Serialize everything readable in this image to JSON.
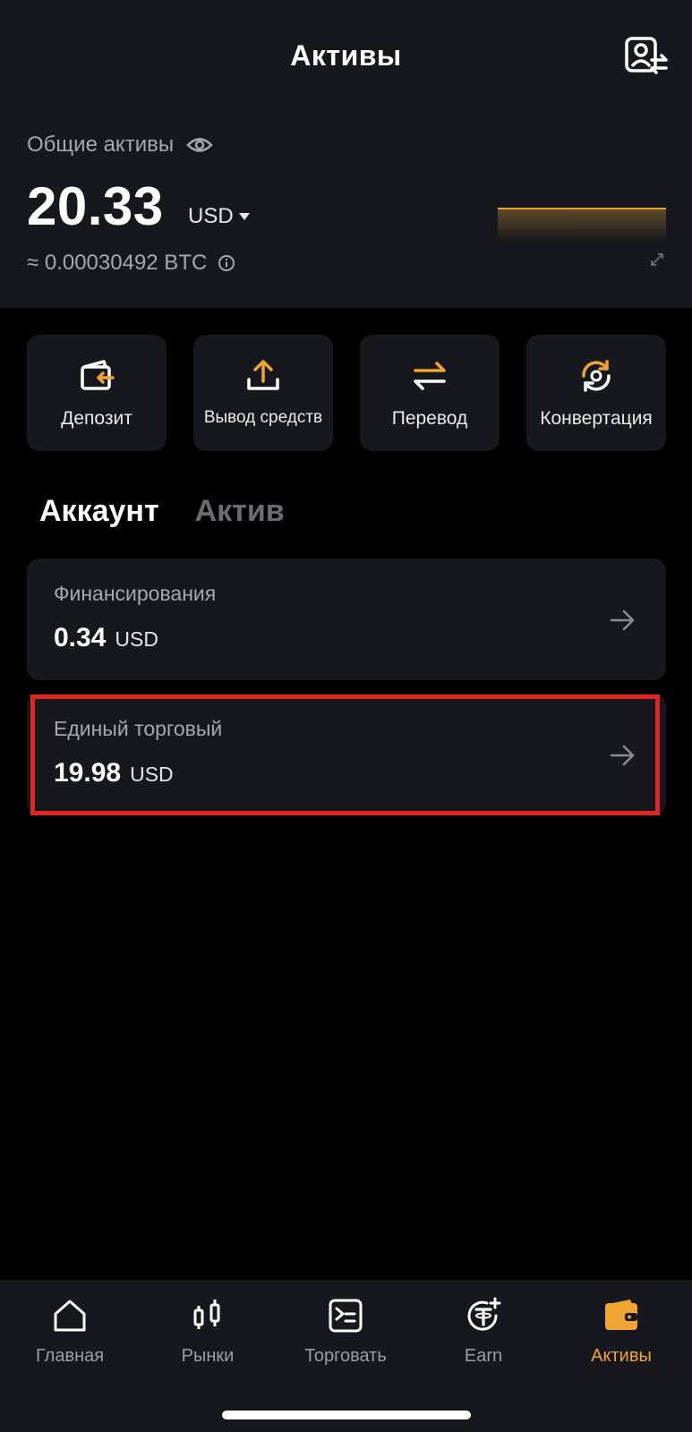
{
  "header": {
    "title": "Активы"
  },
  "summary": {
    "label": "Общие активы",
    "amount": "20.33",
    "currency": "USD",
    "btc_equivalent": "≈ 0.00030492 BTC"
  },
  "actions": [
    {
      "label": "Депозит",
      "icon": "deposit-icon"
    },
    {
      "label": "Вывод средств",
      "icon": "withdraw-icon"
    },
    {
      "label": "Перевод",
      "icon": "transfer-icon"
    },
    {
      "label": "Конвертация",
      "icon": "convert-icon"
    }
  ],
  "tabs": [
    {
      "label": "Аккаунт",
      "active": true
    },
    {
      "label": "Актив",
      "active": false
    }
  ],
  "accounts": [
    {
      "name": "Финансирования",
      "value": "0.34",
      "unit": "USD"
    },
    {
      "name": "Единый торговый",
      "value": "19.98",
      "unit": "USD"
    }
  ],
  "nav": [
    {
      "label": "Главная",
      "icon": "home-icon"
    },
    {
      "label": "Рынки",
      "icon": "markets-icon"
    },
    {
      "label": "Торговать",
      "icon": "trade-icon"
    },
    {
      "label": "Earn",
      "icon": "earn-icon"
    },
    {
      "label": "Активы",
      "icon": "wallet-icon",
      "active": true
    }
  ],
  "colors": {
    "accent": "#f0a432",
    "highlight": "#e0261f",
    "card": "#17181d"
  }
}
